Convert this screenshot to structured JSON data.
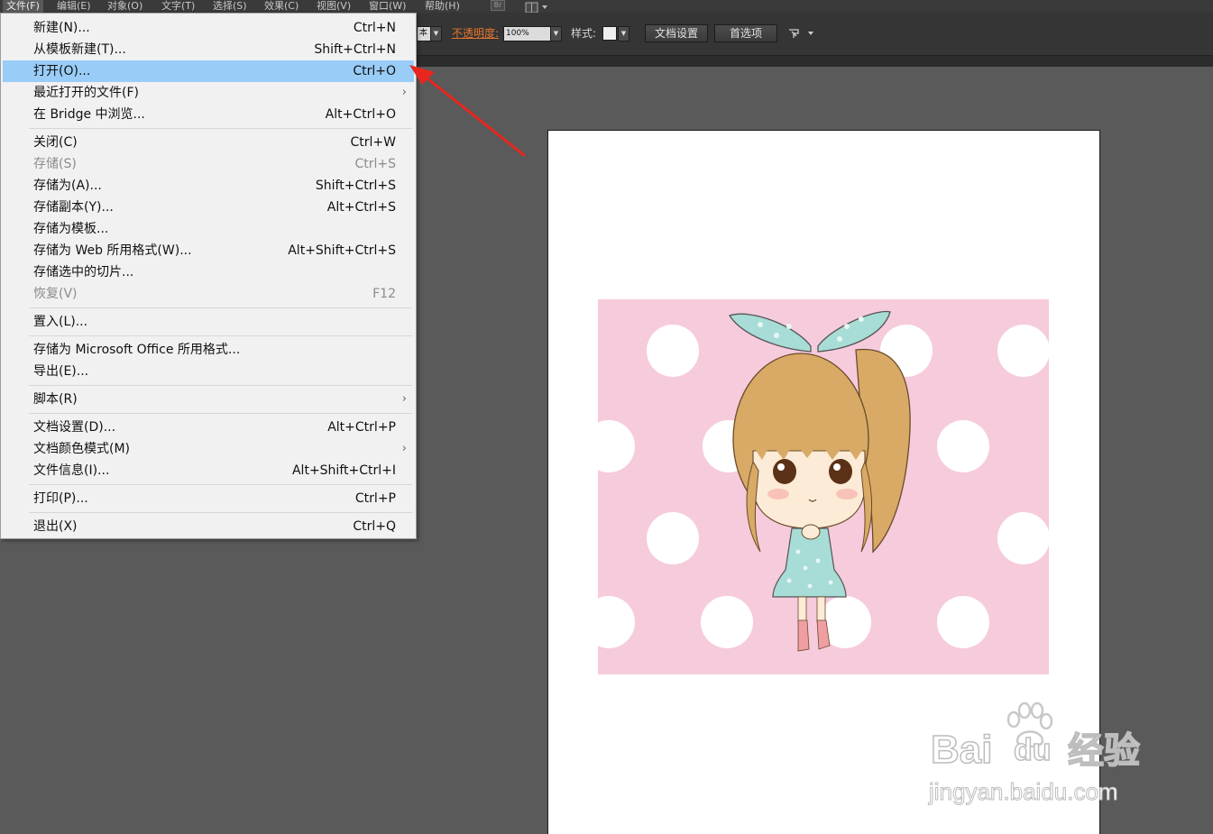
{
  "menubar": {
    "items": [
      "文件(F)",
      "编辑(E)",
      "对象(O)",
      "文字(T)",
      "选择(S)",
      "效果(C)",
      "视图(V)",
      "窗口(W)",
      "帮助(H)"
    ],
    "bridge_icon": "Br"
  },
  "controlbar": {
    "mode_text": "本",
    "opacity_label": "不透明度:",
    "opacity_value": "100%",
    "style_label": "样式:",
    "doc_setup": "文档设置",
    "preferences": "首选项"
  },
  "file_menu": {
    "items": [
      {
        "label": "新建(N)...",
        "shortcut": "Ctrl+N"
      },
      {
        "label": "从模板新建(T)...",
        "shortcut": "Shift+Ctrl+N"
      },
      {
        "label": "打开(O)...",
        "shortcut": "Ctrl+O",
        "highlighted": true
      },
      {
        "label": "最近打开的文件(F)",
        "shortcut": "",
        "submenu": true
      },
      {
        "label": "在 Bridge 中浏览...",
        "shortcut": "Alt+Ctrl+O"
      },
      {
        "label": "关闭(C)",
        "shortcut": "Ctrl+W"
      },
      {
        "label": "存储(S)",
        "shortcut": "Ctrl+S",
        "disabled": true
      },
      {
        "label": "存储为(A)...",
        "shortcut": "Shift+Ctrl+S"
      },
      {
        "label": "存储副本(Y)...",
        "shortcut": "Alt+Ctrl+S"
      },
      {
        "label": "存储为模板...",
        "shortcut": ""
      },
      {
        "label": "存储为 Web 所用格式(W)...",
        "shortcut": "Alt+Shift+Ctrl+S"
      },
      {
        "label": "存储选中的切片...",
        "shortcut": ""
      },
      {
        "label": "恢复(V)",
        "shortcut": "F12",
        "disabled": true
      },
      {
        "label": "置入(L)...",
        "shortcut": ""
      },
      {
        "label": "存储为 Microsoft Office 所用格式...",
        "shortcut": ""
      },
      {
        "label": "导出(E)...",
        "shortcut": ""
      },
      {
        "label": "脚本(R)",
        "shortcut": "",
        "submenu": true
      },
      {
        "label": "文档设置(D)...",
        "shortcut": "Alt+Ctrl+P"
      },
      {
        "label": "文档颜色模式(M)",
        "shortcut": "",
        "submenu": true
      },
      {
        "label": "文件信息(I)...",
        "shortcut": "Alt+Shift+Ctrl+I"
      },
      {
        "label": "打印(P)...",
        "shortcut": "Ctrl+P"
      },
      {
        "label": "退出(X)",
        "shortcut": "Ctrl+Q"
      }
    ]
  },
  "watermark": {
    "brand": "Bai",
    "brand_du": "du",
    "brand_cn": "经验",
    "url": "jingyan.baidu.com"
  },
  "colors": {
    "menu_highlight": "#99ccf7",
    "arrow": "#e8261e",
    "canvas_bg": "#5a5a5a",
    "artwork_bg": "#f6cbdc"
  },
  "icons": [
    "dropdown-arrow-icon",
    "submenu-arrow-icon",
    "arrange-icon",
    "pointer-arrow-icon",
    "paw-icon"
  ]
}
